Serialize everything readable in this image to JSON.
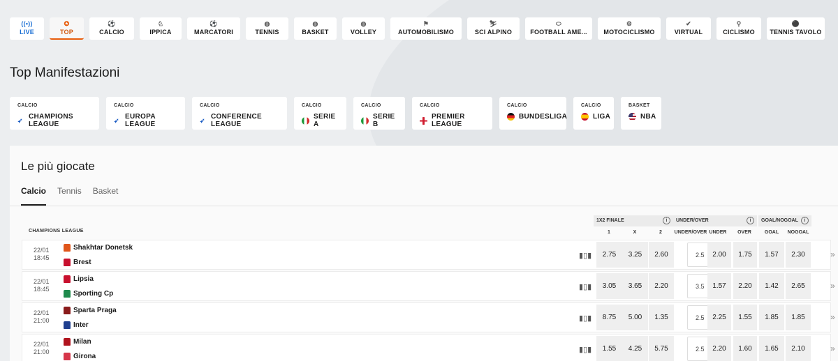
{
  "sports": [
    {
      "label": "LIVE",
      "icon": "live-icon",
      "glyph": "((•))"
    },
    {
      "label": "TOP",
      "icon": "flame-icon",
      "glyph": "✪"
    },
    {
      "label": "CALCIO",
      "icon": "soccer-ball-icon",
      "glyph": "⚽"
    },
    {
      "label": "IPPICA",
      "icon": "horse-icon",
      "glyph": "♘"
    },
    {
      "label": "MARCATORI",
      "icon": "kick-icon",
      "glyph": "⚽"
    },
    {
      "label": "TENNIS",
      "icon": "tennis-ball-icon",
      "glyph": "◍"
    },
    {
      "label": "BASKET",
      "icon": "basketball-icon",
      "glyph": "◍"
    },
    {
      "label": "VOLLEY",
      "icon": "volleyball-icon",
      "glyph": "◍"
    },
    {
      "label": "AUTOMOBILISMO",
      "icon": "checkered-flag-icon",
      "glyph": "⚑"
    },
    {
      "label": "SCI ALPINO",
      "icon": "skier-icon",
      "glyph": "⛷"
    },
    {
      "label": "FOOTBALL AME...",
      "icon": "american-football-icon",
      "glyph": "⬭"
    },
    {
      "label": "MOTOCICLISMO",
      "icon": "motorbike-icon",
      "glyph": "⚙"
    },
    {
      "label": "VIRTUAL",
      "icon": "virtual-icon",
      "glyph": "✔"
    },
    {
      "label": "CICLISMO",
      "icon": "bicycle-icon",
      "glyph": "⚲"
    },
    {
      "label": "TENNIS TAVOLO",
      "icon": "table-tennis-icon",
      "glyph": "⚫"
    }
  ],
  "top_title": "Top Manifestazioni",
  "top_events": [
    {
      "category": "CALCIO",
      "name": "CHAMPIONS LEAGUE",
      "flag": "star"
    },
    {
      "category": "CALCIO",
      "name": "EUROPA LEAGUE",
      "flag": "star"
    },
    {
      "category": "CALCIO",
      "name": "CONFERENCE LEAGUE",
      "flag": "star"
    },
    {
      "category": "CALCIO",
      "name": "SERIE A",
      "flag": "it"
    },
    {
      "category": "CALCIO",
      "name": "SERIE B",
      "flag": "it"
    },
    {
      "category": "CALCIO",
      "name": "PREMIER LEAGUE",
      "flag": "en"
    },
    {
      "category": "CALCIO",
      "name": "BUNDESLIGA",
      "flag": "de"
    },
    {
      "category": "CALCIO",
      "name": "LIGA",
      "flag": "es"
    },
    {
      "category": "BASKET",
      "name": "NBA",
      "flag": "us"
    }
  ],
  "panel_title": "Le più giocate",
  "panel_tabs": [
    "Calcio",
    "Tennis",
    "Basket"
  ],
  "competition": "CHAMPIONS LEAGUE",
  "markets": {
    "m1x2": {
      "title": "1X2 FINALE",
      "cols": [
        "1",
        "X",
        "2"
      ]
    },
    "uo": {
      "title": "UNDER/OVER",
      "cols": [
        "UNDER/OVER",
        "UNDER",
        "OVER"
      ]
    },
    "gg": {
      "title": "GOAL/NOGOAL",
      "cols": [
        "GOAL",
        "NOGOAL"
      ]
    }
  },
  "colors": {
    "accent": "#e85d0c",
    "live": "#1a6fd4"
  },
  "matches": [
    {
      "date": "22/01",
      "time": "18:45",
      "home": "Shakhtar Donetsk",
      "away": "Brest",
      "home_shirt": "#e0561b",
      "away_shirt": "#c8102e",
      "odds": [
        "2.75",
        "3.25",
        "2.60"
      ],
      "line": "2.5",
      "under": "2.00",
      "over": "1.75",
      "goal": "1.57",
      "nogoal": "2.30"
    },
    {
      "date": "22/01",
      "time": "18:45",
      "home": "Lipsia",
      "away": "Sporting Cp",
      "home_shirt": "#c8102e",
      "away_shirt": "#1e8a4c",
      "odds": [
        "3.05",
        "3.65",
        "2.20"
      ],
      "line": "3.5",
      "under": "1.57",
      "over": "2.20",
      "goal": "1.42",
      "nogoal": "2.65"
    },
    {
      "date": "22/01",
      "time": "21:00",
      "home": "Sparta Praga",
      "away": "Inter",
      "home_shirt": "#8a1c1c",
      "away_shirt": "#1f3f8f",
      "odds": [
        "8.75",
        "5.00",
        "1.35"
      ],
      "line": "2.5",
      "under": "2.25",
      "over": "1.55",
      "goal": "1.85",
      "nogoal": "1.85"
    },
    {
      "date": "22/01",
      "time": "21:00",
      "home": "Milan",
      "away": "Girona",
      "home_shirt": "#b0141e",
      "away_shirt": "#d6364a",
      "odds": [
        "1.55",
        "4.25",
        "5.75"
      ],
      "line": "2.5",
      "under": "2.20",
      "over": "1.60",
      "goal": "1.65",
      "nogoal": "2.10"
    }
  ]
}
